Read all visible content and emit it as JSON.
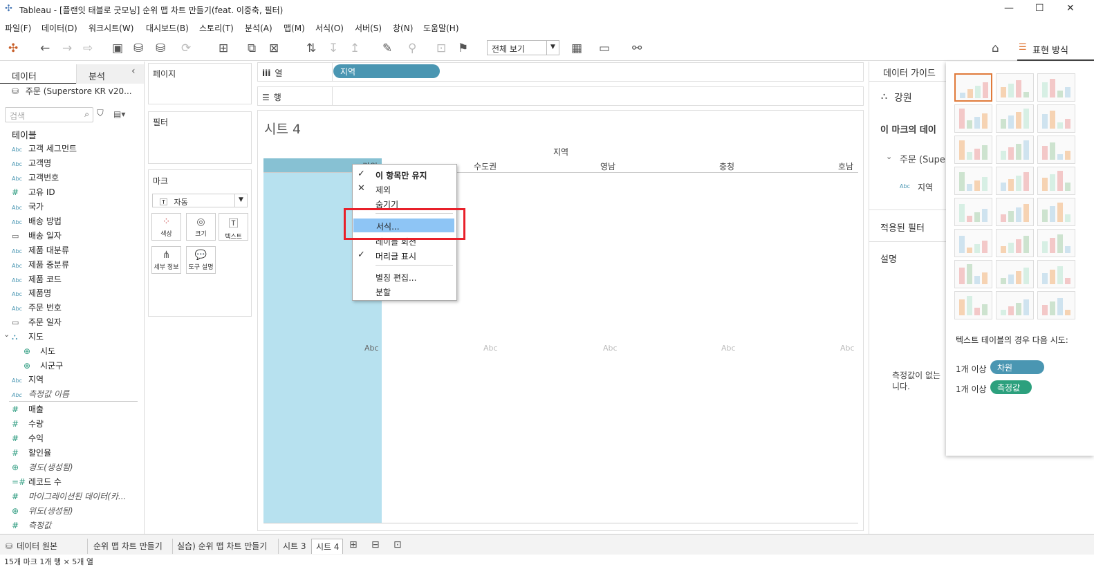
{
  "window": {
    "title": "Tableau - [플랜잇 태블로 굿모닝] 순위 맵 차트 만들기(feat. 이중축, 필터)",
    "min": "—",
    "max": "☐",
    "close": "✕"
  },
  "menu": [
    "파일(F)",
    "데이터(D)",
    "워크시트(W)",
    "대시보드(B)",
    "스토리(T)",
    "분석(A)",
    "맵(M)",
    "서식(O)",
    "서버(S)",
    "창(N)",
    "도움말(H)"
  ],
  "toolbar": {
    "view_value": "전체 보기",
    "showme_label": "표현 방식"
  },
  "left": {
    "tab_data": "데이터",
    "tab_analysis": "분석",
    "datasource": "주문 (Superstore KR v20...",
    "search_placeholder": "검색",
    "tables_label": "테이블",
    "fields": [
      {
        "icon": "Abc",
        "name": "고객 세그먼트"
      },
      {
        "icon": "Abc",
        "name": "고객명"
      },
      {
        "icon": "Abc",
        "name": "고객번호"
      },
      {
        "icon": "#",
        "name": "고유 ID"
      },
      {
        "icon": "Abc",
        "name": "국가"
      },
      {
        "icon": "Abc",
        "name": "배송 방법"
      },
      {
        "icon": "cal",
        "name": "배송 일자"
      },
      {
        "icon": "Abc",
        "name": "제품 대분류"
      },
      {
        "icon": "Abc",
        "name": "제품 중분류"
      },
      {
        "icon": "Abc",
        "name": "제품 코드"
      },
      {
        "icon": "Abc",
        "name": "제품명"
      },
      {
        "icon": "Abc",
        "name": "주문 번호"
      },
      {
        "icon": "cal",
        "name": "주문 일자"
      },
      {
        "icon": "hier",
        "name": "지도"
      },
      {
        "icon": "globe",
        "name": "시도"
      },
      {
        "icon": "globe",
        "name": "시군구"
      },
      {
        "icon": "Abc",
        "name": "지역"
      },
      {
        "icon": "Abc",
        "name": "측정값 이름"
      },
      {
        "icon": "#",
        "name": "매출"
      },
      {
        "icon": "#",
        "name": "수량"
      },
      {
        "icon": "#",
        "name": "수익"
      },
      {
        "icon": "#",
        "name": "할인율"
      },
      {
        "icon": "globe",
        "name": "경도(생성됨)"
      },
      {
        "icon": "=#",
        "name": "레코드 수"
      },
      {
        "icon": "#",
        "name": "마이그레이션된 데이터(카..."
      },
      {
        "icon": "globe",
        "name": "위도(생성됨)"
      },
      {
        "icon": "#",
        "name": "측정값"
      }
    ]
  },
  "cards": {
    "pages": "페이지",
    "filters": "필터",
    "marks": "마크",
    "marks_type": "자동",
    "mark_buttons": {
      "color": "색상",
      "size": "크기",
      "text": "텍스트",
      "detail": "세부 정보",
      "tooltip": "도구 설명"
    }
  },
  "shelves": {
    "columns_label": "열",
    "rows_label": "행",
    "columns_pill": "지역"
  },
  "viz": {
    "sheet_title": "시트 4",
    "column_header_title": "지역",
    "columns": [
      "강원",
      "수도권",
      "영남",
      "충청",
      "호남"
    ],
    "cell_text": "Abc"
  },
  "context_menu": {
    "items": [
      {
        "label": "이 항목만 유지",
        "mark": "✓",
        "bold": true
      },
      {
        "label": "제외",
        "mark": "✕"
      },
      {
        "label": "숨기기",
        "mark": ""
      },
      {
        "label": "서식...",
        "mark": "",
        "highlighted": true
      },
      {
        "label": "레이블 회전",
        "mark": ""
      },
      {
        "label": "머리글 표시",
        "mark": "✓"
      },
      {
        "label": "별칭 편집...",
        "mark": ""
      },
      {
        "label": "분할",
        "mark": ""
      }
    ]
  },
  "guide": {
    "title": "데이터 가이드",
    "item": "강원",
    "marks_data": "이 마크의 데이",
    "source": "주문 (Supe",
    "field_icon": "Abc",
    "field": "지역",
    "filters": "적용된 필터",
    "description": "설명",
    "no_measure": "측정값이 없는",
    "no_measure_2": "니다."
  },
  "showme": {
    "hint": "텍스트 테이블의 경우 다음 시도:",
    "req1_prefix": "1개 이상",
    "req1": "차원",
    "req2_prefix": "1개 이상",
    "req2": "측정값"
  },
  "tabs": [
    "데이터 원본",
    "순위 맵 차트 만들기",
    "실습) 순위 맵 차트 만들기",
    "시트 3",
    "시트 4"
  ],
  "status": "15개 마크   1개 행 × 5개 열",
  "colors": {
    "pill_dim": "#4a96b2",
    "pill_measure": "#2ca07d",
    "selected_col": "#b7e1ef",
    "highlight": "#8ec5f5",
    "callout": "#e8202a"
  }
}
